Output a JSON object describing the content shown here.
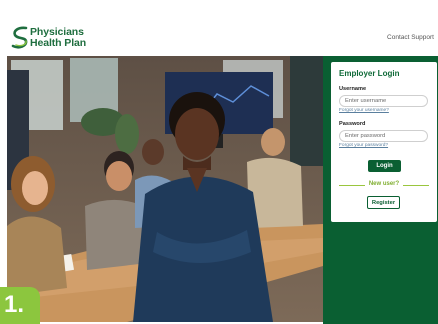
{
  "header": {
    "brand_line1": "Physicians",
    "brand_line2": "Health Plan",
    "contact_link": "Contact Support"
  },
  "login": {
    "title": "Employer Login",
    "username_label": "Username",
    "username_placeholder": "Enter username",
    "forgot_username": "Forgot your username?",
    "password_label": "Password",
    "password_placeholder": "Enter password",
    "forgot_password": "Forgot your password?",
    "login_button": "Login",
    "new_user": "New user?",
    "register_button": "Register"
  },
  "step_badge": "1.",
  "colors": {
    "brand_green": "#0a5f32",
    "accent_lime": "#8cc63e",
    "link_blue": "#5a7f9e"
  }
}
